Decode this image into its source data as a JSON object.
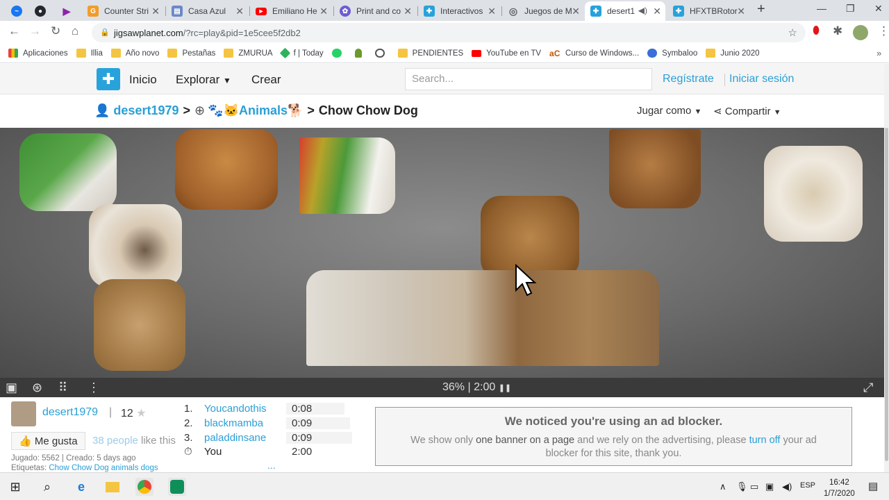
{
  "tabs": [
    {
      "title": "",
      "icon": "messenger-icon",
      "color": "#1877f2"
    },
    {
      "title": "",
      "icon": "github-icon",
      "color": "#24292e"
    },
    {
      "title": "",
      "icon": "play-icon",
      "color": "#8e24aa"
    },
    {
      "title": "Counter Stri",
      "icon": "counter-strike-icon",
      "color": "#f09d2a"
    },
    {
      "title": "Casa Azul",
      "icon": "casa-azul-icon",
      "color": "#6b88c7"
    },
    {
      "title": "Emiliano He",
      "icon": "youtube-icon",
      "color": "#ff0000"
    },
    {
      "title": "Print and co",
      "icon": "print-icon",
      "color": "#6d5bd0"
    },
    {
      "title": "Interactivos",
      "icon": "jigsaw-icon",
      "color": "#27a2db"
    },
    {
      "title": "Juegos de M",
      "icon": "globe-icon",
      "color": "#5f6368"
    },
    {
      "title": "desert1",
      "icon": "jigsaw-icon",
      "color": "#27a2db",
      "active": true
    },
    {
      "title": "HFXTBRotor",
      "icon": "jigsaw-icon",
      "color": "#27a2db"
    }
  ],
  "url": {
    "host": "jigsawplanet.com",
    "path": "/?rc=play&pid=1e5cee5f2db2"
  },
  "bookmarks": [
    {
      "label": "Aplicaciones",
      "icon": "apps-grid-icon"
    },
    {
      "label": "Illia",
      "icon": "folder-icon"
    },
    {
      "label": "Año novo",
      "icon": "folder-icon"
    },
    {
      "label": "Pestañas",
      "icon": "folder-icon"
    },
    {
      "label": "ZMURUA",
      "icon": "folder-icon"
    },
    {
      "label": "f | Today",
      "icon": "today-icon"
    },
    {
      "label": "",
      "icon": "whatsapp-icon"
    },
    {
      "label": "",
      "icon": "chess-icon"
    },
    {
      "label": "",
      "icon": "history-icon"
    },
    {
      "label": "PENDIENTES",
      "icon": "folder-icon"
    },
    {
      "label": "YouTube en TV",
      "icon": "youtube-icon"
    },
    {
      "label": "Curso de Windows...",
      "icon": "ac-icon"
    },
    {
      "label": "Symbaloo",
      "icon": "symbaloo-icon"
    },
    {
      "label": "Junio 2020",
      "icon": "folder-icon"
    }
  ],
  "site": {
    "nav_inicio": "Inicio",
    "nav_explorar": "Explorar",
    "nav_crear": "Crear",
    "search_placeholder": "Search...",
    "register": "Regístrate",
    "login": "Iniciar sesión"
  },
  "breadcrumb": {
    "user": "desert1979",
    "sep": ">",
    "category": "Animals",
    "puzzle": "Chow Chow Dog",
    "play_as": "Jugar como",
    "share": "Compartir"
  },
  "game": {
    "progress": "36%",
    "time": "2:00",
    "progress_separator": "|"
  },
  "author": {
    "name": "desert1979",
    "count": "12",
    "like_button": "Me gusta",
    "like_people": "38 people",
    "like_this": "like this",
    "played_label": "Jugado:",
    "played": "5562",
    "created_label": "Creado:",
    "created": "5 days ago",
    "tags_label": "Etiquetas:",
    "tags": "Chow Chow Dog animals dogs"
  },
  "leaderboard": [
    {
      "rank": "1.",
      "name": "Youcandothis",
      "time": "0:08"
    },
    {
      "rank": "2.",
      "name": "blackmamba",
      "time": "0:09"
    },
    {
      "rank": "3.",
      "name": "paladdinsane",
      "time": "0:09"
    },
    {
      "rank": "⏱",
      "name": "You",
      "time": "2:00"
    }
  ],
  "leaderboard_more": "...",
  "adblock": {
    "title": "We noticed you're using an ad blocker.",
    "t1": "We show only",
    "t2": "one banner on a page",
    "t3": "and we rely on the advertising, please",
    "t4": "turn off",
    "t5": "your ad blocker for this site, thank you."
  },
  "taskbar": {
    "lang": "ESP",
    "time": "16:42",
    "date": "1/7/2020"
  }
}
